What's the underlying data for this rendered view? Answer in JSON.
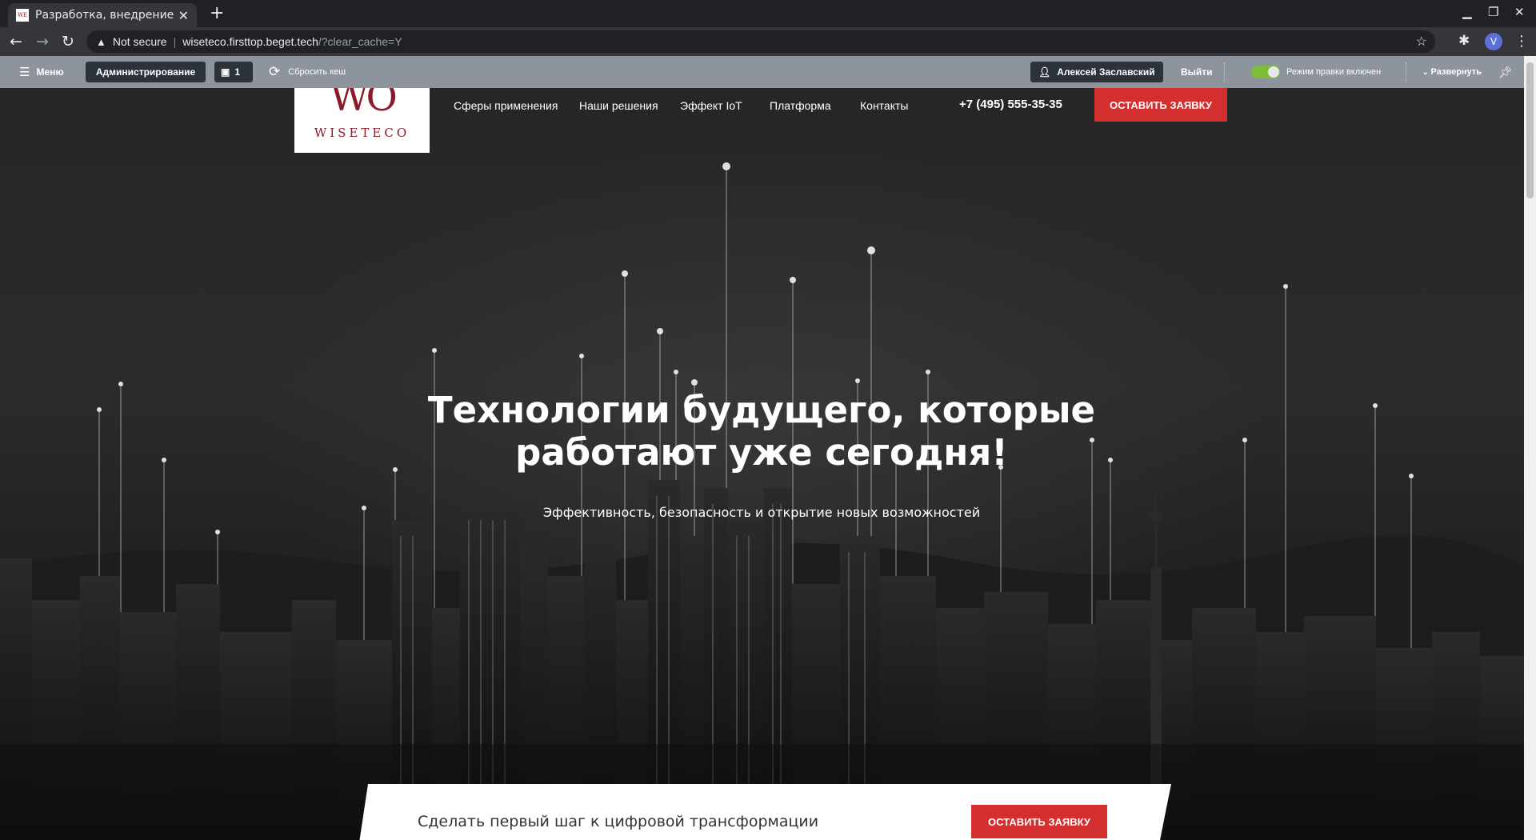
{
  "browser": {
    "tab_title": "Разработка, внедрение и по",
    "favicon_text": "WE",
    "url_warning": "Not secure",
    "url_host": "wiseteco.firsttop.beget.tech",
    "url_path": "/?clear_cache=Y",
    "profile_initial": "V"
  },
  "admin": {
    "menu_label": "Меню",
    "admin_label": "Администрирование",
    "notifications_count": "1",
    "clear_cache_label": "Сбросить кеш",
    "user_name": "Алексей Заславский",
    "logout_label": "Выйти",
    "edit_mode_label": "Режим правки включен",
    "expand_label": "Развернуть",
    "edit_mode_on": true
  },
  "site": {
    "logo_mark": "WO",
    "logo_word": "WISETECO",
    "nav": [
      "Сферы применения",
      "Наши решения",
      "Эффект IoT",
      "Платформа",
      "Контакты"
    ],
    "phone": "+7 (495) 555-35-35",
    "cta_top": "ОСТАВИТЬ ЗАЯВКУ",
    "hero_title_line1": "Технологии будущего, которые",
    "hero_title_line2": "работают уже сегодня!",
    "hero_subtitle": "Эффективность, безопасность и открытие новых возможностей",
    "card_text": "Сделать первый шаг к цифровой трансформации",
    "card_cta": "ОСТАВИТЬ ЗАЯВКУ"
  },
  "colors": {
    "accent": "#d32f2f",
    "brand": "#8b1a2a",
    "admin_bar": "#8d949b",
    "toggle_on": "#7dbd3a"
  }
}
